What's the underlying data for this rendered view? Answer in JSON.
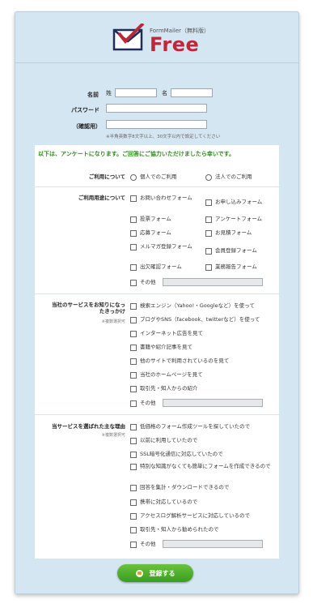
{
  "logo": {
    "small": "FormMailer（無料版）",
    "big": "Free"
  },
  "top": {
    "name_label": "名前",
    "sei_label": "姓",
    "mei_label": "名",
    "password_label": "パスワード",
    "confirm_label": "（確認用）",
    "password_note": "※半角英数字8文字以上、30文字以内で設定してください"
  },
  "intro": "以下は、アンケートになります。ご回答にご協力いただけましたら幸いです。",
  "q1": {
    "label": "ご利用について",
    "options": [
      "個人でのご利用",
      "法人でのご利用"
    ]
  },
  "q2": {
    "label": "ご利用用途について",
    "options": [
      "お問い合わせフォーム",
      "お申し込みフォーム",
      "投票フォーム",
      "アンケートフォーム",
      "応募フォーム",
      "お見積フォーム",
      "メルマガ登録フォーム",
      "会員登録フォーム",
      "出欠確認フォーム",
      "業務報告フォーム",
      "その他"
    ]
  },
  "q3": {
    "label_line1": "当社のサービスをお知りになっ",
    "label_line2": "たきっかけ",
    "note": "※複数選択可",
    "options": [
      "検索エンジン（Yahoo!・Googleなど）を使って",
      "ブログやSNS（facebook、twitterなど）を使って",
      "インターネット広告を見て",
      "書籍や紹介記事を見て",
      "他のサイトで利用されているのを見て",
      "当社のホームページを見て",
      "取引先・知人からの紹介",
      "その他"
    ]
  },
  "q4": {
    "label": "当サービスを選ばれた主な理由",
    "note": "※複数選択可",
    "options": [
      "低価格のフォーム作成ツールを探していたので",
      "以前に利用していたので",
      "SSL暗号化通信に対応していたので",
      "特別な知識がなくても簡単にフォームを作成できるので",
      "回答を集計・ダウンロードできるので",
      "携帯に対応しているので",
      "アクセスログ解析サービスに対応しているので",
      "取引先・知人から勧められたので",
      "その他"
    ]
  },
  "submit_label": "登録する"
}
